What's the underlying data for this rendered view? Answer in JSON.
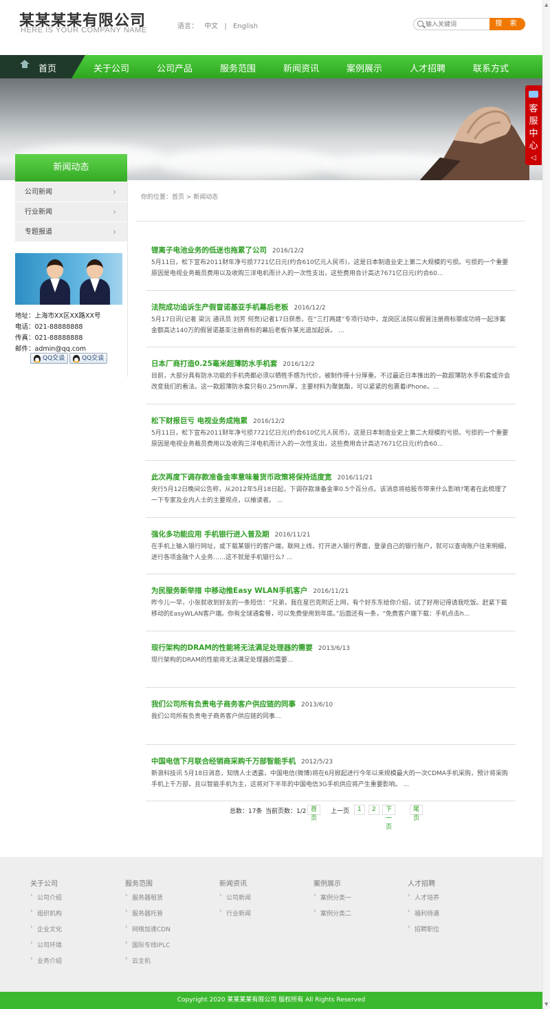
{
  "header": {
    "company_name": "某某某某有限公司",
    "company_sub": "HERE IS YOUR COMPANY NAME",
    "lang_label": "语言：",
    "lang_cn": "中文",
    "lang_sep": "|",
    "lang_en": "English",
    "search_placeholder": "输入关键词",
    "search_button": "搜 索"
  },
  "nav": {
    "home": "首页",
    "items": [
      "关于公司",
      "公司产品",
      "服务范围",
      "新闻资讯",
      "案例展示",
      "人才招聘",
      "联系方式"
    ]
  },
  "kefu": {
    "label": "客服中心",
    "arrow": "◁"
  },
  "sidebar": {
    "title": "新闻动态",
    "items": [
      "公司新闻",
      "行业新闻",
      "专题报道"
    ],
    "address": "地址：上海市XX区XX路XX号",
    "phone": "电话：021-88888888",
    "fax": "传真：021-88888888",
    "email": "邮件：admin@qq.com",
    "qq1": "QQ交谈",
    "qq2": "QQ交谈"
  },
  "breadcrumb": "你的位置：首页 > 新闻动态",
  "news": [
    {
      "title": "锂离子电池业务的低迷也拖累了公司",
      "date": "2016/12/2",
      "desc": "5月11日，松下宣布2011财年净亏损7721亿日元(约合610亿元人民币)，这是日本制造业史上第二大规模的亏损。亏损的一个重要原因是电视业务裁员费用以及收购三洋电机而计入的一次性支出，这些费用合计高达7671亿日元(约合60..."
    },
    {
      "title": "法院成功追诉生产假冒诺基亚手机幕后老板",
      "date": "2016/12/2",
      "desc": "5月17日讯(记者 梁沅 通讯员 刘芳 何亮)记者17日获悉，在“三打两建”专项行动中，龙岗区法院以假冒注册商标罪成功将一起涉案金额高达140万的假冒诺基亚注册商标的幕后老板许某光追加起诉。 ..."
    },
    {
      "title": "日本厂商打造0.25毫米超薄防水手机套",
      "date": "2016/12/2",
      "desc": "目前，大部分具有防水功能的手机壳都必须以牺牲手感为代价，被制作得十分厚重。不过最近日本推出的一款超薄防水手机套或许会改变我们的看法。这一款超薄防水套只有0.25mm厚，主要材料为聚氨酯，可以紧紧的包裹着iPhone。..."
    },
    {
      "title": "松下财报巨亏 电视业务成拖累",
      "date": "2016/12/2",
      "desc": "5月11日，松下宣布2011财年净亏损7721亿日元(约合610亿元人民币)，这是日本制造业史上第二大规模的亏损。亏损的一个重要原因是电视业务裁员费用以及收购三洋电机而计入的一次性支出，这些费用合计高达7671亿日元(约合60..."
    },
    {
      "title": "此次再度下调存款准备金率意味着货币政策将保持适度宽",
      "date": "2016/11/21",
      "desc": "央行5月12日晚间公告称，从2012年5月18日起，下调存款准备金率0.5个百分点。该消息将给股市带来什么影响?笔者在此梳理了一下专家及业内人士的主要观点，以飨读者。 ..."
    },
    {
      "title": "强化多功能应用 手机银行进入普及期",
      "date": "2016/11/21",
      "desc": "在手机上输入银行网址，或下载某银行的客户端，联网上线，打开进入银行界面，登录自己的银行账户，就可以查询账户往来明细，进行各项金融个人业务……这不就是手机银行么? ..."
    },
    {
      "title": "为民服务新举措 中移动推Easy WLAN手机客户",
      "date": "2016/11/21",
      "desc": "昨今儿一早，小张就收到好友的一条短信：“兄弟，我在星巴克附近上网，有个好东东给你介绍，试了好用记得请我吃饭。赶紧下载移动的EasyWLAN客户端。你有全球通套餐，可以免费使用到年底。”后面还有一条，“免费客户端下载：手机点击h..."
    },
    {
      "title": "现行架构的DRAM的性能将无法满足处理器的需要",
      "date": "2013/6/13",
      "desc": "现行架构的DRAM的性能将无法满足处理器的需要..."
    },
    {
      "title": "我们公司所有负责电子商务客户供应链的同事",
      "date": "2013/6/10",
      "desc": "我们公司所有负责电子商务客户供应链的同事..."
    },
    {
      "title": "中国电信下月联合经销商采购千万部智能手机",
      "date": "2012/5/23",
      "desc": "新浪科技讯 5月18日消息，知情人士透露，中国电信(微博)将在6月掀起进行今年以来规模最大的一次CDMA手机采购，预计将采购手机上千万部，且以智能手机为主，这将对下半年的中国电信3G手机供应将产生重要影响。 ..."
    }
  ],
  "pager": {
    "total": "总数：17条",
    "current": "当前页数：1/2",
    "first": "首页",
    "prev": "上一页",
    "p1": "1",
    "p2": "2",
    "next": "下一页",
    "last": "尾页"
  },
  "footer": {
    "columns": [
      {
        "title": "关于公司",
        "links": [
          "公司介绍",
          "组织机构",
          "企业文化",
          "公司环境",
          "业务介绍"
        ]
      },
      {
        "title": "服务范围",
        "links": [
          "服务器租赁",
          "服务器托管",
          "网络加速CDN",
          "国际专线IPLC",
          "云主机"
        ]
      },
      {
        "title": "新闻资讯",
        "links": [
          "公司新闻",
          "行业新闻"
        ]
      },
      {
        "title": "案例展示",
        "links": [
          "案例分类一",
          "案例分类二"
        ]
      },
      {
        "title": "人才招聘",
        "links": [
          "人才培养",
          "福利待遇",
          "招聘职位"
        ]
      }
    ],
    "copyright": "Copyright 2020 某某某某有限公司 版权所有 All Rights Reserved"
  },
  "colors": {
    "accent_green": "#3bb92e",
    "title_green": "#2e9e24",
    "search_orange": "#f07800",
    "kefu_red": "#cc0000"
  }
}
